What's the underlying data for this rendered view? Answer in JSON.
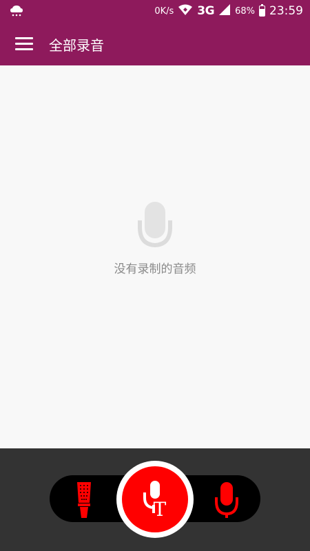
{
  "status_bar": {
    "net_speed": "0K/s",
    "network": "3G",
    "battery": "68%",
    "battery_level": 0.68,
    "time": "23:59",
    "icons": [
      "weather-cloud-icon",
      "wifi-icon",
      "signal-icon",
      "battery-icon"
    ]
  },
  "app_bar": {
    "menu_icon": "hamburger-menu-icon",
    "title": "全部录音"
  },
  "empty_state": {
    "icon": "microphone-icon",
    "message": "没有录制的音频"
  },
  "bottom_controls": {
    "left_button_icon": "vintage-microphone-icon",
    "center_button_icon": "voice-to-text-microphone-icon",
    "center_letter": "T",
    "right_button_icon": "microphone-icon"
  },
  "colors": {
    "primary": "#8e1a5c",
    "accent": "#ff0000",
    "background": "#f8f8f8",
    "bottom_bar": "#333333"
  }
}
